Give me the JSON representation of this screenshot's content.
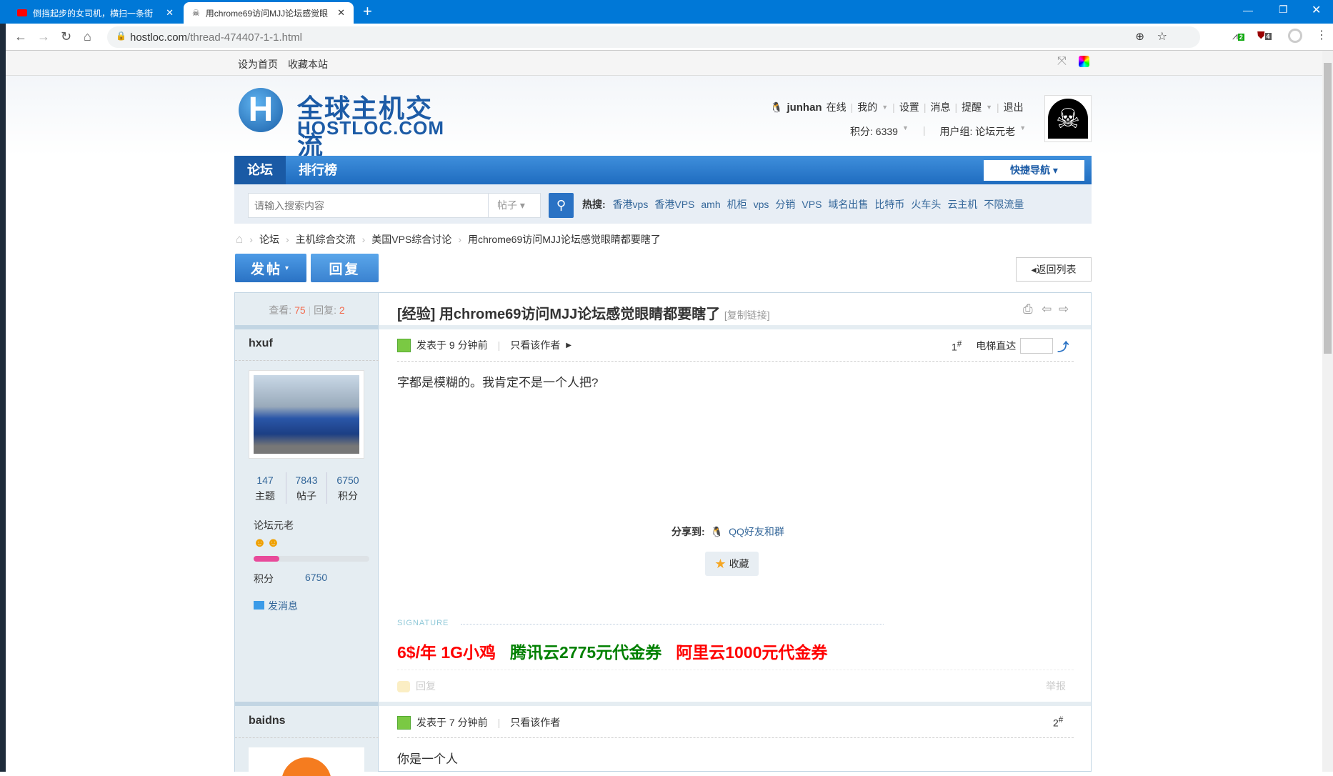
{
  "browser": {
    "tabs": [
      {
        "title": "倒挡起步的女司机，横扫一条街",
        "active": false
      },
      {
        "title": "用chrome69访问MJJ论坛感觉眼",
        "active": true
      }
    ],
    "url_host": "hostloc.com",
    "url_path": "/thread-474407-1-1.html",
    "ext_badge_1": "2",
    "ext_badge_2": "4"
  },
  "topstrip": {
    "set_home": "设为首页",
    "bookmark": "收藏本站"
  },
  "logo": {
    "cn": "全球主机交流",
    "en": "HOSTLOC.COM"
  },
  "user": {
    "name": "junhan",
    "status": "在线",
    "menu": [
      "我的",
      "设置",
      "消息",
      "提醒",
      "退出"
    ],
    "points": "积分: 6339",
    "group": "用户组: 论坛元老"
  },
  "nav": {
    "items": [
      "论坛",
      "排行榜"
    ],
    "quick": "快捷导航"
  },
  "search": {
    "placeholder": "请输入搜索内容",
    "type": "帖子",
    "hot_label": "热搜:",
    "hot": [
      "香港vps",
      "香港VPS",
      "amh",
      "机柜",
      "vps",
      "分销",
      "VPS",
      "域名出售",
      "比特币",
      "火车头",
      "云主机",
      "不限流量"
    ]
  },
  "breadcrumb": [
    "论坛",
    "主机综合交流",
    "美国VPS综合讨论",
    "用chrome69访问MJJ论坛感觉眼睛都要瞎了"
  ],
  "actions": {
    "post": "发帖",
    "reply": "回复",
    "back": "返回列表"
  },
  "thread": {
    "views_label": "查看:",
    "views": "75",
    "replies_label": "回复:",
    "replies": "2",
    "type": "[经验]",
    "title": "用chrome69访问MJJ论坛感觉眼睛都要瞎了",
    "copy_link": "[复制链接]"
  },
  "posts": [
    {
      "author": "hxuf",
      "stats": [
        {
          "n": "147",
          "l": "主题"
        },
        {
          "n": "7843",
          "l": "帖子"
        },
        {
          "n": "6750",
          "l": "积分"
        }
      ],
      "rank": "论坛元老",
      "points_label": "积分",
      "points": "6750",
      "level_progress": 0.22,
      "pm": "发消息",
      "time": "发表于 9 分钟前",
      "only_author": "只看该作者",
      "floor": "1",
      "floor_sup": "#",
      "jump_label": "电梯直达",
      "content": "字都是模糊的。我肯定不是一个人把?",
      "share_label": "分享到:",
      "share_qq": "QQ好友和群",
      "fav": "收藏",
      "signature_label": "SIGNATURE",
      "signature": [
        {
          "text": "6$/年 1G小鸡",
          "color": "#ff0000"
        },
        {
          "text": "腾讯云2775元代金券",
          "color": "#008000"
        },
        {
          "text": "阿里云1000元代金券",
          "color": "#ff0000"
        }
      ],
      "reply": "回复",
      "report": "举报"
    },
    {
      "author": "baidns",
      "time": "发表于 7 分钟前",
      "only_author": "只看该作者",
      "floor": "2",
      "floor_sup": "#",
      "content": "你是一个人"
    }
  ]
}
